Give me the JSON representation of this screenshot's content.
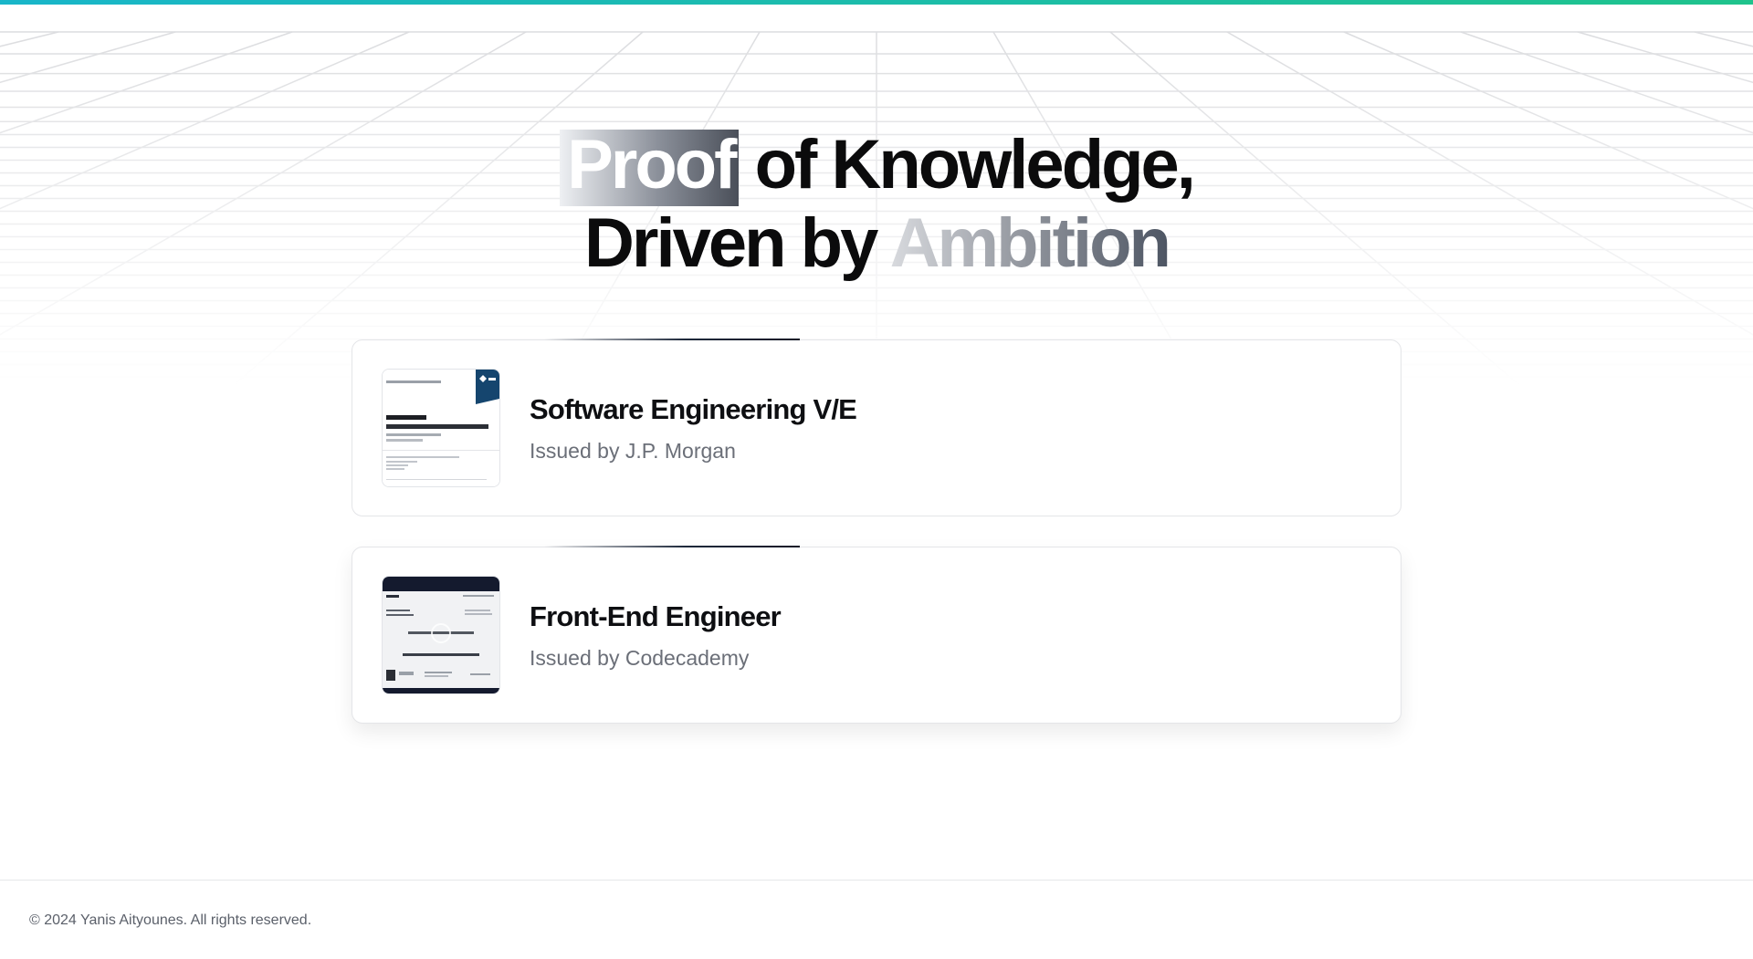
{
  "hero": {
    "line1_highlight": "Proof",
    "line1_rest": " of Knowledge,",
    "line2_start": "Driven by ",
    "line2_highlight": "Ambition"
  },
  "certificates": [
    {
      "title": "Software Engineering V/E",
      "issuer": "Issued by J.P. Morgan",
      "thumbnail_icon": "jpmorgan-certificate-thumbnail"
    },
    {
      "title": "Front-End Engineer",
      "issuer": "Issued by Codecademy",
      "thumbnail_icon": "codecademy-certificate-thumbnail"
    }
  ],
  "footer": {
    "copyright": "© 2024 Yanis Aityounes. All rights reserved."
  },
  "colors": {
    "accent_start": "#19b6c9",
    "accent_end": "#1fc38c",
    "text_primary": "#0b0b0c",
    "text_secondary": "#6b6f78"
  }
}
